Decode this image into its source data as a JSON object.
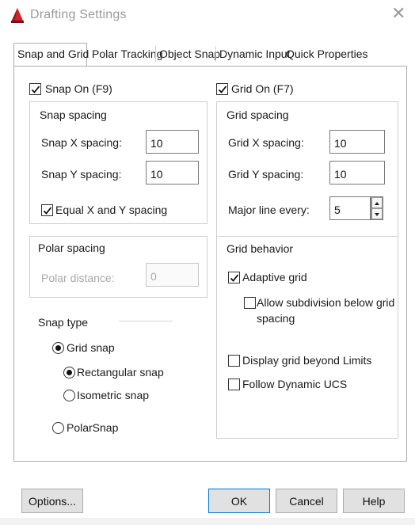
{
  "window": {
    "title": "Drafting Settings",
    "close_icon": "close-icon"
  },
  "tabs": [
    {
      "label": "Snap and Grid",
      "active": true
    },
    {
      "label": "Polar Tracking",
      "active": false
    },
    {
      "label": "Object Snap",
      "active": false
    },
    {
      "label": "Dynamic Input",
      "active": false
    },
    {
      "label": "Quick Properties",
      "active": false
    }
  ],
  "snap": {
    "snap_on_label": "Snap On (F9)",
    "snap_on_checked": true,
    "spacing_heading": "Snap spacing",
    "x_label": "Snap X spacing:",
    "x_value": "10",
    "y_label": "Snap Y spacing:",
    "y_value": "10",
    "equal_label": "Equal X and Y spacing",
    "equal_checked": true,
    "polar_heading": "Polar spacing",
    "polar_label": "Polar distance:",
    "polar_value": "0",
    "type_heading": "Snap type",
    "grid_snap_label": "Grid snap",
    "rect_snap_label": "Rectangular snap",
    "iso_snap_label": "Isometric snap",
    "polarsnap_label": "PolarSnap",
    "selected_type": "Grid snap",
    "selected_style": "Rectangular snap"
  },
  "grid": {
    "grid_on_label": "Grid On (F7)",
    "grid_on_checked": true,
    "spacing_heading": "Grid spacing",
    "x_label": "Grid X spacing:",
    "x_value": "10",
    "y_label": "Grid Y spacing:",
    "y_value": "10",
    "major_label": "Major line every:",
    "major_value": "5",
    "behavior_heading": "Grid behavior",
    "adaptive_label": "Adaptive grid",
    "adaptive_checked": true,
    "subdivision_label_1": "Allow subdivision below grid",
    "subdivision_label_2": "spacing",
    "subdivision_checked": false,
    "beyond_label": "Display grid beyond Limits",
    "beyond_checked": false,
    "dynamic_ucs_label": "Follow Dynamic UCS",
    "dynamic_ucs_checked": false
  },
  "buttons": {
    "options": "Options...",
    "ok": "OK",
    "cancel": "Cancel",
    "help": "Help"
  },
  "colors": {
    "accent": "#0078d7",
    "icon_red": "#d2232a"
  }
}
